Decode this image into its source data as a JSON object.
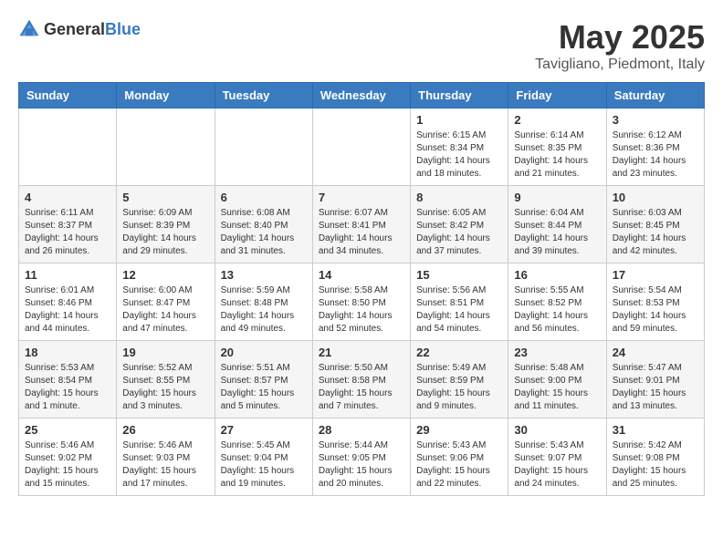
{
  "header": {
    "logo_general": "General",
    "logo_blue": "Blue",
    "month": "May 2025",
    "location": "Tavigliano, Piedmont, Italy"
  },
  "days_of_week": [
    "Sunday",
    "Monday",
    "Tuesday",
    "Wednesday",
    "Thursday",
    "Friday",
    "Saturday"
  ],
  "weeks": [
    [
      {
        "day": "",
        "info": ""
      },
      {
        "day": "",
        "info": ""
      },
      {
        "day": "",
        "info": ""
      },
      {
        "day": "",
        "info": ""
      },
      {
        "day": "1",
        "info": "Sunrise: 6:15 AM\nSunset: 8:34 PM\nDaylight: 14 hours and 18 minutes."
      },
      {
        "day": "2",
        "info": "Sunrise: 6:14 AM\nSunset: 8:35 PM\nDaylight: 14 hours and 21 minutes."
      },
      {
        "day": "3",
        "info": "Sunrise: 6:12 AM\nSunset: 8:36 PM\nDaylight: 14 hours and 23 minutes."
      }
    ],
    [
      {
        "day": "4",
        "info": "Sunrise: 6:11 AM\nSunset: 8:37 PM\nDaylight: 14 hours and 26 minutes."
      },
      {
        "day": "5",
        "info": "Sunrise: 6:09 AM\nSunset: 8:39 PM\nDaylight: 14 hours and 29 minutes."
      },
      {
        "day": "6",
        "info": "Sunrise: 6:08 AM\nSunset: 8:40 PM\nDaylight: 14 hours and 31 minutes."
      },
      {
        "day": "7",
        "info": "Sunrise: 6:07 AM\nSunset: 8:41 PM\nDaylight: 14 hours and 34 minutes."
      },
      {
        "day": "8",
        "info": "Sunrise: 6:05 AM\nSunset: 8:42 PM\nDaylight: 14 hours and 37 minutes."
      },
      {
        "day": "9",
        "info": "Sunrise: 6:04 AM\nSunset: 8:44 PM\nDaylight: 14 hours and 39 minutes."
      },
      {
        "day": "10",
        "info": "Sunrise: 6:03 AM\nSunset: 8:45 PM\nDaylight: 14 hours and 42 minutes."
      }
    ],
    [
      {
        "day": "11",
        "info": "Sunrise: 6:01 AM\nSunset: 8:46 PM\nDaylight: 14 hours and 44 minutes."
      },
      {
        "day": "12",
        "info": "Sunrise: 6:00 AM\nSunset: 8:47 PM\nDaylight: 14 hours and 47 minutes."
      },
      {
        "day": "13",
        "info": "Sunrise: 5:59 AM\nSunset: 8:48 PM\nDaylight: 14 hours and 49 minutes."
      },
      {
        "day": "14",
        "info": "Sunrise: 5:58 AM\nSunset: 8:50 PM\nDaylight: 14 hours and 52 minutes."
      },
      {
        "day": "15",
        "info": "Sunrise: 5:56 AM\nSunset: 8:51 PM\nDaylight: 14 hours and 54 minutes."
      },
      {
        "day": "16",
        "info": "Sunrise: 5:55 AM\nSunset: 8:52 PM\nDaylight: 14 hours and 56 minutes."
      },
      {
        "day": "17",
        "info": "Sunrise: 5:54 AM\nSunset: 8:53 PM\nDaylight: 14 hours and 59 minutes."
      }
    ],
    [
      {
        "day": "18",
        "info": "Sunrise: 5:53 AM\nSunset: 8:54 PM\nDaylight: 15 hours and 1 minute."
      },
      {
        "day": "19",
        "info": "Sunrise: 5:52 AM\nSunset: 8:55 PM\nDaylight: 15 hours and 3 minutes."
      },
      {
        "day": "20",
        "info": "Sunrise: 5:51 AM\nSunset: 8:57 PM\nDaylight: 15 hours and 5 minutes."
      },
      {
        "day": "21",
        "info": "Sunrise: 5:50 AM\nSunset: 8:58 PM\nDaylight: 15 hours and 7 minutes."
      },
      {
        "day": "22",
        "info": "Sunrise: 5:49 AM\nSunset: 8:59 PM\nDaylight: 15 hours and 9 minutes."
      },
      {
        "day": "23",
        "info": "Sunrise: 5:48 AM\nSunset: 9:00 PM\nDaylight: 15 hours and 11 minutes."
      },
      {
        "day": "24",
        "info": "Sunrise: 5:47 AM\nSunset: 9:01 PM\nDaylight: 15 hours and 13 minutes."
      }
    ],
    [
      {
        "day": "25",
        "info": "Sunrise: 5:46 AM\nSunset: 9:02 PM\nDaylight: 15 hours and 15 minutes."
      },
      {
        "day": "26",
        "info": "Sunrise: 5:46 AM\nSunset: 9:03 PM\nDaylight: 15 hours and 17 minutes."
      },
      {
        "day": "27",
        "info": "Sunrise: 5:45 AM\nSunset: 9:04 PM\nDaylight: 15 hours and 19 minutes."
      },
      {
        "day": "28",
        "info": "Sunrise: 5:44 AM\nSunset: 9:05 PM\nDaylight: 15 hours and 20 minutes."
      },
      {
        "day": "29",
        "info": "Sunrise: 5:43 AM\nSunset: 9:06 PM\nDaylight: 15 hours and 22 minutes."
      },
      {
        "day": "30",
        "info": "Sunrise: 5:43 AM\nSunset: 9:07 PM\nDaylight: 15 hours and 24 minutes."
      },
      {
        "day": "31",
        "info": "Sunrise: 5:42 AM\nSunset: 9:08 PM\nDaylight: 15 hours and 25 minutes."
      }
    ]
  ]
}
